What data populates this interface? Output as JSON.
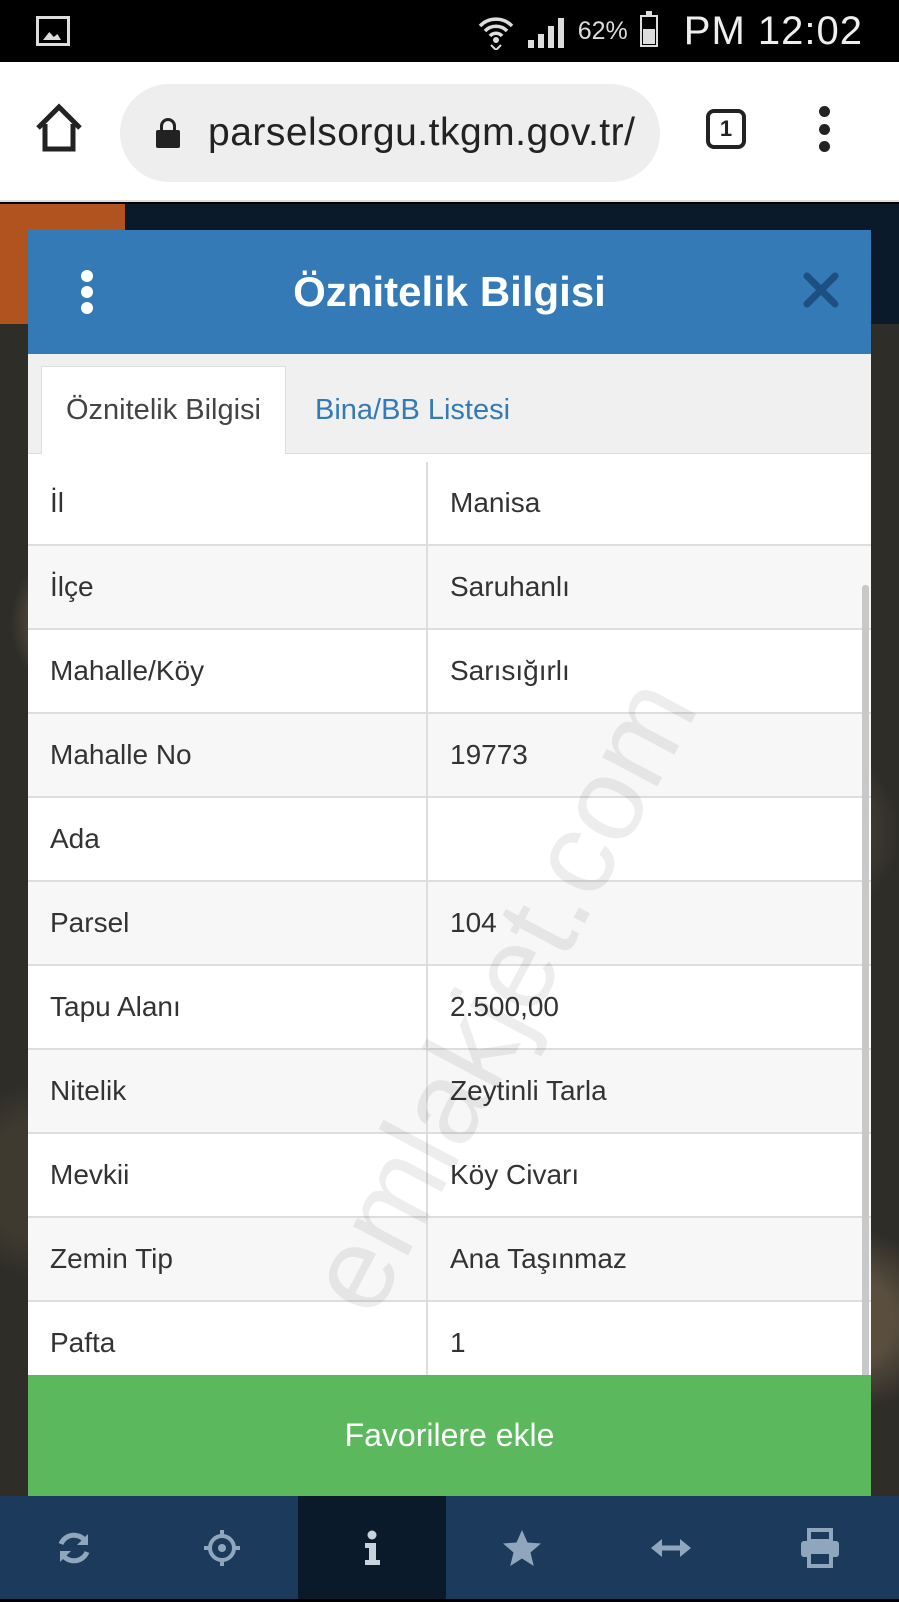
{
  "status_bar": {
    "battery_percent": "62%",
    "time": "PM 12:02",
    "icons": [
      "image-icon",
      "wifi-icon",
      "signal-icon",
      "battery-icon"
    ]
  },
  "browser": {
    "url": "parselsorgu.tkgm.gov.tr/",
    "tab_count": "1",
    "icons": [
      "home-icon",
      "lock-icon",
      "tabs-icon",
      "overflow-menu-icon"
    ]
  },
  "dialog": {
    "title": "Öznitelik Bilgisi",
    "tabs": [
      {
        "label": "Öznitelik Bilgisi",
        "active": true
      },
      {
        "label": "Bina/BB Listesi",
        "active": false
      }
    ],
    "rows": [
      {
        "label": "İl",
        "value": "Manisa"
      },
      {
        "label": "İlçe",
        "value": "Saruhanlı"
      },
      {
        "label": "Mahalle/Köy",
        "value": "Sarısığırlı"
      },
      {
        "label": "Mahalle No",
        "value": "19773"
      },
      {
        "label": "Ada",
        "value": ""
      },
      {
        "label": "Parsel",
        "value": "104"
      },
      {
        "label": "Tapu Alanı",
        "value": "2.500,00"
      },
      {
        "label": "Nitelik",
        "value": "Zeytinli Tarla"
      },
      {
        "label": "Mevkii",
        "value": "Köy Civarı"
      },
      {
        "label": "Zemin Tip",
        "value": "Ana Taşınmaz"
      },
      {
        "label": "Pafta",
        "value": "1"
      }
    ],
    "favorite_button": "Favorilere ekle",
    "watermark": "emlakjet.com",
    "colors": {
      "header": "#337ab7",
      "favorite": "#5cb85c"
    }
  },
  "toolbar": {
    "items": [
      "refresh-icon",
      "locate-icon",
      "info-icon",
      "star-icon",
      "measure-icon",
      "print-icon"
    ],
    "active": "info-icon"
  }
}
